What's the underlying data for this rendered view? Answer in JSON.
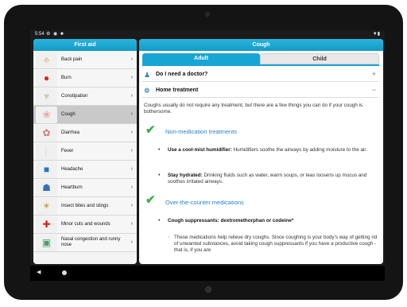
{
  "status": {
    "time": "5:54",
    "left_icons": "⚙ ◉ ■",
    "right_icons": "▼▮"
  },
  "left_panel": {
    "title": "First aid",
    "items": [
      {
        "label": "Back pain",
        "icon": "back-pain-thumb",
        "color": "#e7cdb6"
      },
      {
        "label": "Burn",
        "icon": "burn-thumb",
        "color": "#d7261f"
      },
      {
        "label": "Constipation",
        "icon": "constipation-thumb",
        "color": "#d9c9ad"
      },
      {
        "label": "Cough",
        "icon": "cough-thumb",
        "color": "#e8a6a0"
      },
      {
        "label": "Diarrhea",
        "icon": "diarrhea-thumb",
        "color": "#d67474"
      },
      {
        "label": "Fever",
        "icon": "fever-thumb",
        "color": "#cfe8d2"
      },
      {
        "label": "Headache",
        "icon": "headache-thumb",
        "color": "#2a76c1"
      },
      {
        "label": "Heartburn",
        "icon": "heartburn-thumb",
        "color": "#3a6fb8"
      },
      {
        "label": "Insect bites and stings",
        "icon": "insect-thumb",
        "color": "#c9a23a"
      },
      {
        "label": "Minor cuts and wounds",
        "icon": "first-aid-cross-thumb",
        "color": "#e11f1f"
      },
      {
        "label": "Nasal congestion and runny nose",
        "icon": "nasal-thumb",
        "color": "#4b9e6a"
      }
    ],
    "selected_index": 3
  },
  "right_panel": {
    "title": "Cough",
    "tabs": [
      {
        "label": "Adult",
        "active": true
      },
      {
        "label": "Child",
        "active": false
      }
    ],
    "sections": [
      {
        "title": "Do I need a doctor?",
        "toggle": "+",
        "icon": "doctor-icon"
      },
      {
        "title": "Home treatment",
        "toggle": "−",
        "icon": "home-treatment-icon"
      }
    ],
    "intro": "Coughs usually do not require any treatment, but there are a few things you can do if your cough is bothersome.",
    "non_med": {
      "title": "Non-medication treatments",
      "bullets": [
        {
          "bold": "Use a cool-mist humidifier:",
          "text": " Humidifiers soothe the airways by adding moisture to the air."
        },
        {
          "bold": "Stay hydrated:",
          "text": " Drinking fluids such as water, warm soups, or teas loosens up mucus and soothes irritated airways."
        }
      ]
    },
    "otc": {
      "title": "Over-the-counter medications",
      "bullet_bold": "Cough suppressants: dextromethorphan or codeine*",
      "sub_text": "These medications help relieve dry coughs. Since coughing is your body's way of getting rid of unwanted substances, avoid taking cough suppressants if you have a productive cough - that is, if you are"
    }
  },
  "colors": {
    "accent": "#17a6d3",
    "check": "#3fb04a",
    "link_blue": "#2a80c9"
  }
}
